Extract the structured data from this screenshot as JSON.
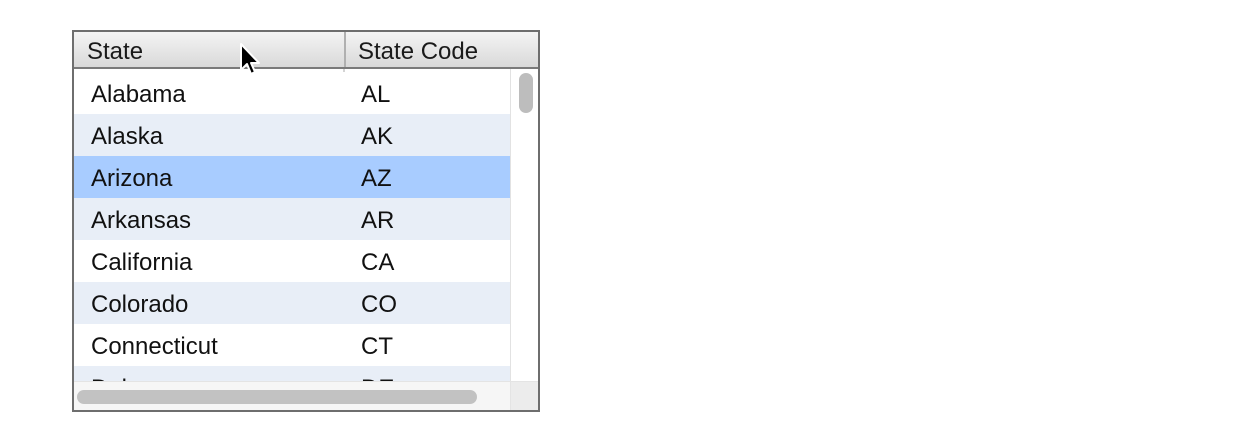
{
  "table": {
    "columns": [
      {
        "key": "state",
        "label": "State"
      },
      {
        "key": "code",
        "label": "State Code"
      }
    ],
    "rows": [
      {
        "state": "Alabama",
        "code": "AL",
        "selected": false
      },
      {
        "state": "Alaska",
        "code": "AK",
        "selected": false
      },
      {
        "state": "Arizona",
        "code": "AZ",
        "selected": true
      },
      {
        "state": "Arkansas",
        "code": "AR",
        "selected": false
      },
      {
        "state": "California",
        "code": "CA",
        "selected": false
      },
      {
        "state": "Colorado",
        "code": "CO",
        "selected": false
      },
      {
        "state": "Connecticut",
        "code": "CT",
        "selected": false
      },
      {
        "state": "Delaware",
        "code": "DE",
        "selected": false
      }
    ],
    "selected_row_color": "#a8ccff",
    "alternate_row_color": "#e8eef7",
    "header_color": "#e4e4e4"
  },
  "cursor": {
    "icon": "pointer-arrow-icon"
  }
}
